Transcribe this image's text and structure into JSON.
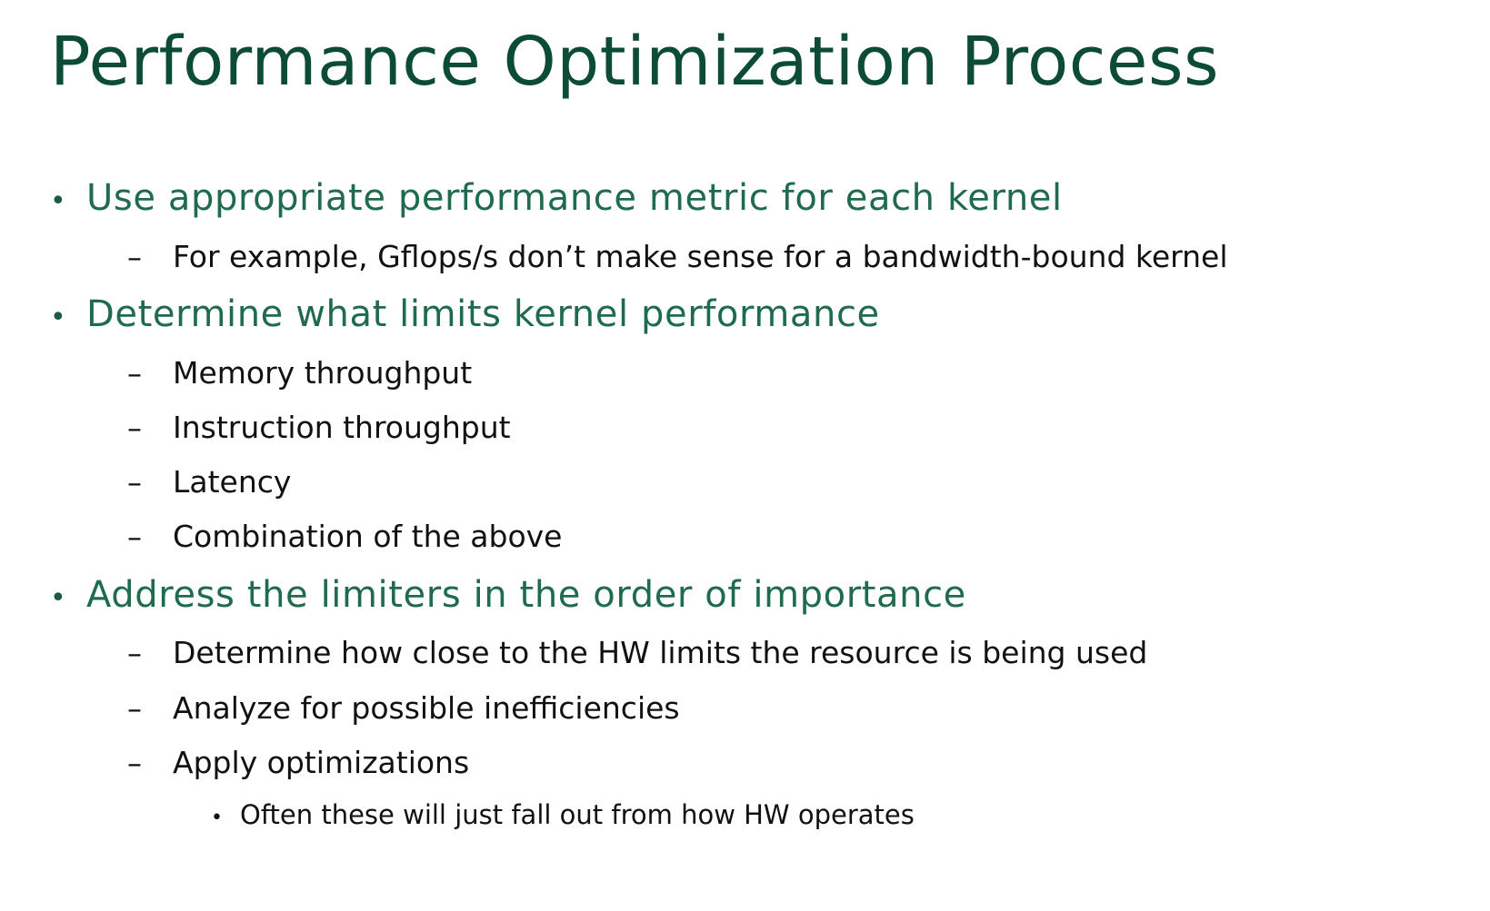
{
  "slide": {
    "title": "Performance Optimization Process",
    "markers": {
      "level1": "•",
      "level2": "–",
      "level3": "•"
    },
    "bullets": [
      {
        "text": "Use appropriate performance metric for each kernel",
        "sub": [
          {
            "text": "For example, Gflops/s don’t make sense for a bandwidth-bound kernel"
          }
        ]
      },
      {
        "text": "Determine what limits kernel performance",
        "sub": [
          {
            "text": "Memory throughput"
          },
          {
            "text": "Instruction throughput"
          },
          {
            "text": "Latency"
          },
          {
            "text": "Combination of the above"
          }
        ]
      },
      {
        "text": "Address the limiters in the order of importance",
        "sub": [
          {
            "text": "Determine how close to the HW limits the resource is being used"
          },
          {
            "text": "Analyze for possible inefficiencies"
          },
          {
            "text": "Apply optimizations",
            "sub": [
              {
                "text": "Often these will just fall out from how HW operates"
              }
            ]
          }
        ]
      }
    ],
    "colors": {
      "title": "#0c4b37",
      "level1_text": "#1f6b4d",
      "body_text": "#111111",
      "background": "#ffffff"
    }
  }
}
